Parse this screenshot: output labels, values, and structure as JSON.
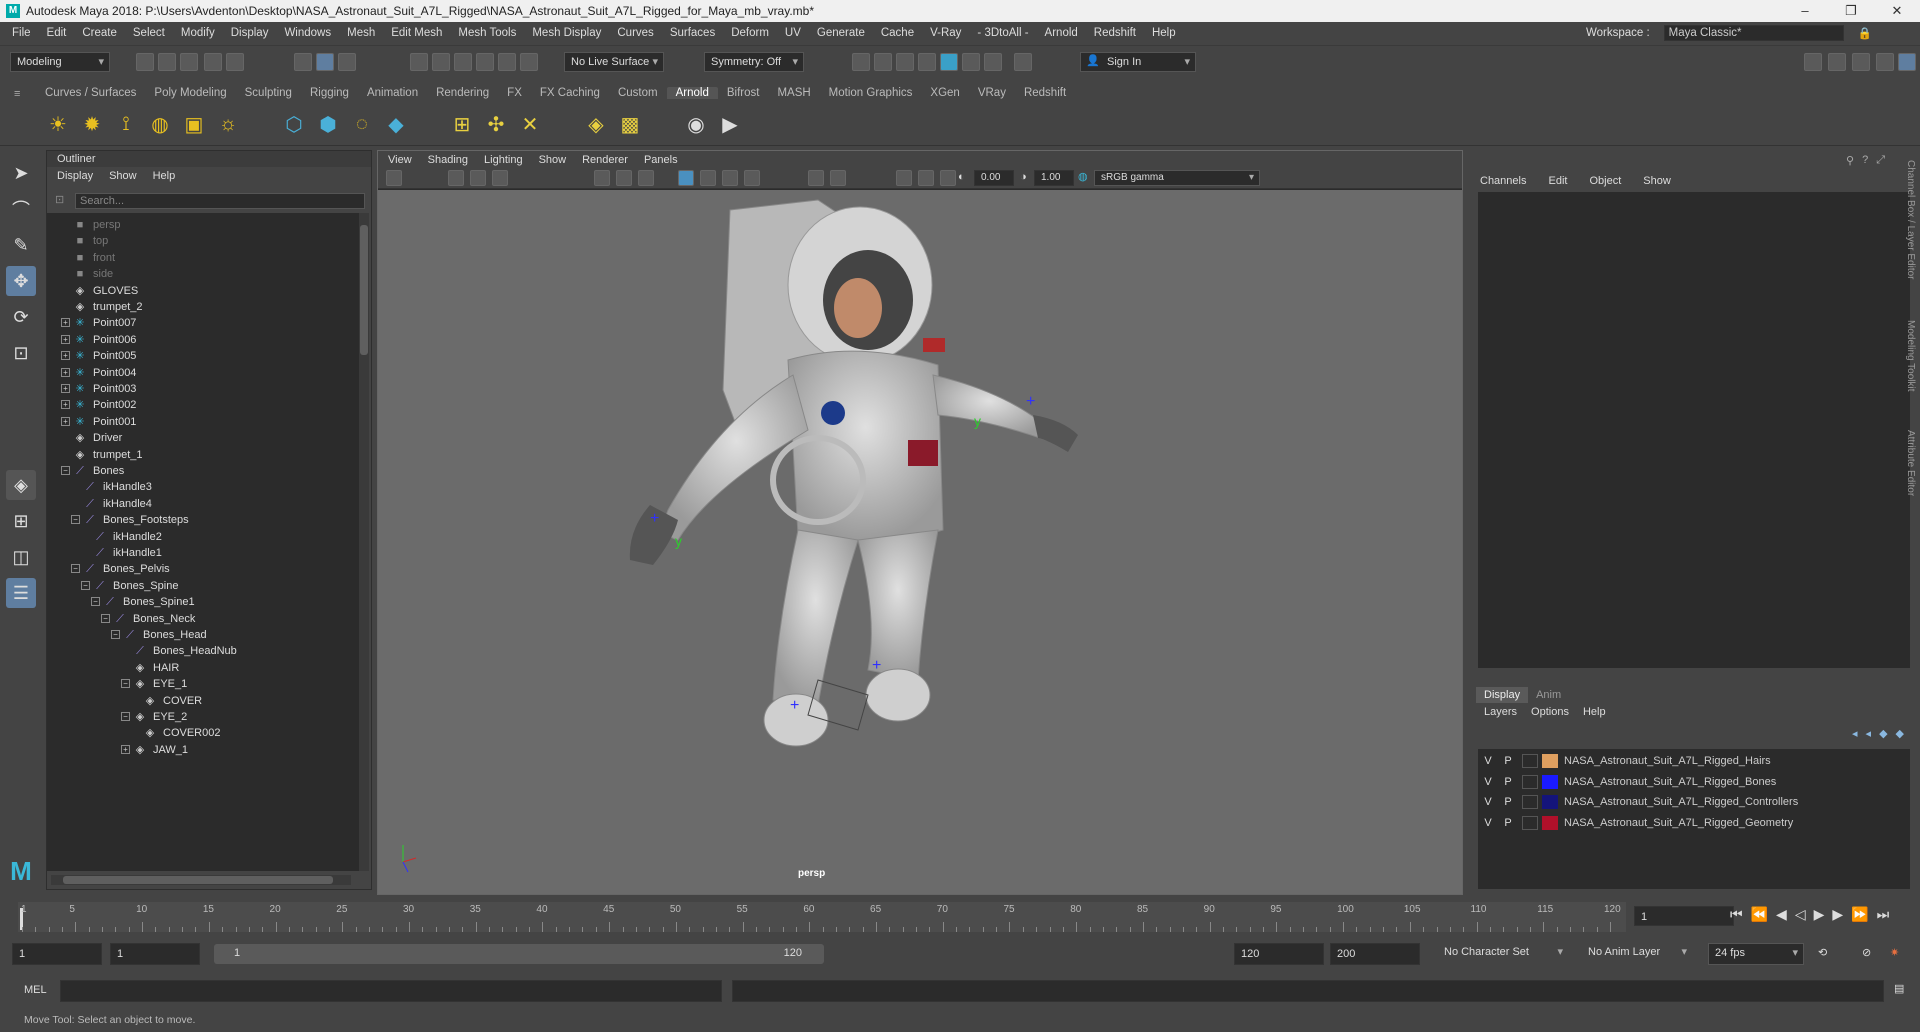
{
  "app": {
    "title": "Autodesk Maya 2018: P:\\Users\\Avdenton\\Desktop\\NASA_Astronaut_Suit_A7L_Rigged\\NASA_Astronaut_Suit_A7L_Rigged_for_Maya_mb_vray.mb*",
    "logo_letter": "M"
  },
  "menus": [
    "File",
    "Edit",
    "Create",
    "Select",
    "Modify",
    "Display",
    "Windows",
    "Mesh",
    "Edit Mesh",
    "Mesh Tools",
    "Mesh Display",
    "Curves",
    "Surfaces",
    "Deform",
    "UV",
    "Generate",
    "Cache",
    "V-Ray",
    "- 3DtoAll -",
    "Arnold",
    "Redshift",
    "Help"
  ],
  "workspace": {
    "label": "Workspace :",
    "value": "Maya Classic*"
  },
  "status": {
    "mode": "Modeling",
    "live_surface": "No Live Surface",
    "symmetry": "Symmetry: Off",
    "sign_in": "Sign In"
  },
  "shelf_tabs": [
    "Curves / Surfaces",
    "Poly Modeling",
    "Sculpting",
    "Rigging",
    "Animation",
    "Rendering",
    "FX",
    "FX Caching",
    "Custom",
    "Arnold",
    "Bifrost",
    "MASH",
    "Motion Graphics",
    "XGen",
    "VRay",
    "Redshift"
  ],
  "shelf_active": "Arnold",
  "outliner": {
    "title": "Outliner",
    "menu": [
      "Display",
      "Show",
      "Help"
    ],
    "search_placeholder": "Search...",
    "items": [
      {
        "label": "persp",
        "indent": 0,
        "icon": "camera",
        "dim": true
      },
      {
        "label": "top",
        "indent": 0,
        "icon": "camera",
        "dim": true
      },
      {
        "label": "front",
        "indent": 0,
        "icon": "camera",
        "dim": true
      },
      {
        "label": "side",
        "indent": 0,
        "icon": "camera",
        "dim": true
      },
      {
        "label": "GLOVES",
        "indent": 0,
        "icon": "transform"
      },
      {
        "label": "trumpet_2",
        "indent": 0,
        "icon": "transform"
      },
      {
        "label": "Point007",
        "indent": 0,
        "icon": "light",
        "exp": "+"
      },
      {
        "label": "Point006",
        "indent": 0,
        "icon": "light",
        "exp": "+"
      },
      {
        "label": "Point005",
        "indent": 0,
        "icon": "light",
        "exp": "+"
      },
      {
        "label": "Point004",
        "indent": 0,
        "icon": "light",
        "exp": "+"
      },
      {
        "label": "Point003",
        "indent": 0,
        "icon": "light",
        "exp": "+"
      },
      {
        "label": "Point002",
        "indent": 0,
        "icon": "light",
        "exp": "+"
      },
      {
        "label": "Point001",
        "indent": 0,
        "icon": "light",
        "exp": "+"
      },
      {
        "label": "Driver",
        "indent": 0,
        "icon": "transform"
      },
      {
        "label": "trumpet_1",
        "indent": 0,
        "icon": "transform"
      },
      {
        "label": "Bones",
        "indent": 0,
        "icon": "joint",
        "exp": "-"
      },
      {
        "label": "ikHandle3",
        "indent": 1,
        "icon": "joint"
      },
      {
        "label": "ikHandle4",
        "indent": 1,
        "icon": "joint"
      },
      {
        "label": "Bones_Footsteps",
        "indent": 1,
        "icon": "joint",
        "exp": "-"
      },
      {
        "label": "ikHandle2",
        "indent": 2,
        "icon": "joint"
      },
      {
        "label": "ikHandle1",
        "indent": 2,
        "icon": "joint"
      },
      {
        "label": "Bones_Pelvis",
        "indent": 1,
        "icon": "joint",
        "exp": "-"
      },
      {
        "label": "Bones_Spine",
        "indent": 2,
        "icon": "joint",
        "exp": "-"
      },
      {
        "label": "Bones_Spine1",
        "indent": 3,
        "icon": "joint",
        "exp": "-"
      },
      {
        "label": "Bones_Neck",
        "indent": 4,
        "icon": "joint",
        "exp": "-"
      },
      {
        "label": "Bones_Head",
        "indent": 5,
        "icon": "joint",
        "exp": "-"
      },
      {
        "label": "Bones_HeadNub",
        "indent": 6,
        "icon": "joint"
      },
      {
        "label": "HAIR",
        "indent": 6,
        "icon": "transform"
      },
      {
        "label": "EYE_1",
        "indent": 6,
        "icon": "transform",
        "exp": "-"
      },
      {
        "label": "COVER",
        "indent": 7,
        "icon": "transform"
      },
      {
        "label": "EYE_2",
        "indent": 6,
        "icon": "transform",
        "exp": "-"
      },
      {
        "label": "COVER002",
        "indent": 7,
        "icon": "transform"
      },
      {
        "label": "JAW_1",
        "indent": 6,
        "icon": "transform",
        "exp": "+"
      }
    ]
  },
  "viewport": {
    "menu": [
      "View",
      "Shading",
      "Lighting",
      "Show",
      "Renderer",
      "Panels"
    ],
    "exposure": "0.00",
    "gamma": "1.00",
    "colorspace": "sRGB gamma",
    "camera_label": "persp"
  },
  "channel_box": {
    "menu": [
      "Channels",
      "Edit",
      "Object",
      "Show"
    ]
  },
  "layers": {
    "tabs": [
      "Display",
      "Anim"
    ],
    "menu": [
      "Layers",
      "Options",
      "Help"
    ],
    "rows": [
      {
        "v": "V",
        "p": "P",
        "color": "#e0a060",
        "name": "NASA_Astronaut_Suit_A7L_Rigged_Hairs"
      },
      {
        "v": "V",
        "p": "P",
        "color": "#1a1aff",
        "name": "NASA_Astronaut_Suit_A7L_Rigged_Bones"
      },
      {
        "v": "V",
        "p": "P",
        "color": "#14147a",
        "name": "NASA_Astronaut_Suit_A7L_Rigged_Controllers"
      },
      {
        "v": "V",
        "p": "P",
        "color": "#b0102a",
        "name": "NASA_Astronaut_Suit_A7L_Rigged_Geometry"
      }
    ]
  },
  "side_tabs": [
    "Channel Box / Layer Editor",
    "Modeling Toolkit",
    "Attribute Editor"
  ],
  "timeline": {
    "ticks": [
      "5",
      "10",
      "15",
      "20",
      "25",
      "30",
      "35",
      "40",
      "45",
      "50",
      "55",
      "60",
      "65",
      "70",
      "75",
      "80",
      "85",
      "90",
      "95",
      "100",
      "105",
      "110",
      "115",
      "120"
    ],
    "start_tick": "1",
    "current_frame": "1"
  },
  "range": {
    "start": "1",
    "playback_start": "1",
    "slider_start": "1",
    "slider_end": "120",
    "playback_end": "120",
    "end": "200",
    "character_set": "No Character Set",
    "anim_layer": "No Anim Layer",
    "fps": "24 fps"
  },
  "mel_label": "MEL",
  "help_text": "Move Tool: Select an object to move."
}
